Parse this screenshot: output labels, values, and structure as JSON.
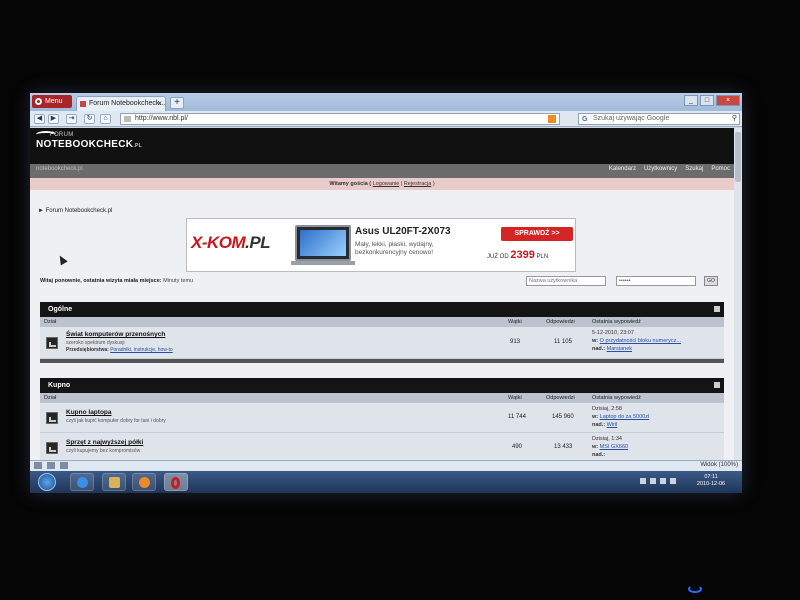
{
  "browser": {
    "menu_label": "Menu",
    "tab_title": "Forum Notebookcheck...",
    "new_tab": "+",
    "url": "http://www.nbl.pl/",
    "search_placeholder": "Szukaj używając Google",
    "win_min": "_",
    "win_max": "□",
    "win_close": "×",
    "tab_close": "×"
  },
  "site": {
    "logo_forum": "FORUM",
    "logo_main": "NOTEBOOKCHECK",
    "logo_pl": ".PL",
    "domain": "notebookcheck.pl",
    "nav": [
      "Kalendarz",
      "Użytkownicy",
      "Szukaj",
      "Pomoc"
    ],
    "welcome_prefix": "Witamy gościa ( ",
    "login": "Logowanie",
    "sep": " | ",
    "register": "Rejestracja",
    "welcome_suffix": " )",
    "breadcrumb": "► Forum Notebookcheck.pl"
  },
  "ad": {
    "brand": "X-KOM",
    "brand_suffix": ".PL",
    "model": "Asus UL20FT-2X073",
    "description": "Mały, lekki, płaski, wydajny, bezkonkurencyjny cenowo!",
    "cta": "SPRAWDŹ >>",
    "price_prefix": "JUŻ OD",
    "price": "2399",
    "currency": "PLN"
  },
  "lastvisit": {
    "text": "Witaj ponownie, ostatnia wizyta miała miejsce:",
    "value": "Minuty temu"
  },
  "login_form": {
    "username_placeholder": "Nazwa użytkownika",
    "password_value": "••••••",
    "go": "GO"
  },
  "sections": [
    {
      "title": "Ogólne",
      "cols": {
        "dzial": "Dział",
        "watki": "Wątki",
        "odpowiedzi": "Odpowiedzi",
        "ostatnia": "Ostatnia wypowiedź"
      },
      "rows": [
        {
          "title": "Świat komputerów przenośnych",
          "desc": "szeroko spektrum dyskusji",
          "mods_label": "Przedsiębiorstwa:",
          "mods": "Poradniki, instrukcje, how-to",
          "threads": "913",
          "replies": "11 105",
          "last_date": "5-12-2010, 23:07",
          "last_prefix": "w:",
          "last_topic": "O przydatności bloku numerycz...",
          "last_by_prefix": "nad.:",
          "last_by": "Marsianek"
        }
      ]
    },
    {
      "title": "Kupno",
      "cols": {
        "dzial": "Dział",
        "watki": "Wątki",
        "odpowiedzi": "Odpowiedzi",
        "ostatnia": "Ostatnia wypowiedź"
      },
      "rows": [
        {
          "title": "Kupno laptopa",
          "desc": "czyli jak kupić komputer dobry for tani i dobry",
          "threads": "11 744",
          "replies": "145 960",
          "last_date": "Dzisiaj, 2:58",
          "last_prefix": "w:",
          "last_topic": "Laptop do za 5000zł",
          "last_by_prefix": "nad.:",
          "last_by": "Wiril"
        },
        {
          "title": "Sprzęt z najwyższej półki",
          "desc": "czyli kupujemy bez kompromisów",
          "threads": "490",
          "replies": "13 433",
          "last_date": "Dzisiaj, 1:34",
          "last_prefix": "w:",
          "last_topic": "MSI GX660",
          "last_by_prefix": "nad.:",
          "last_by": ""
        }
      ]
    }
  ],
  "status": {
    "zoom": "Widok (100%)"
  },
  "taskbar": {
    "time": "07:11",
    "date": "2010-12-06"
  }
}
